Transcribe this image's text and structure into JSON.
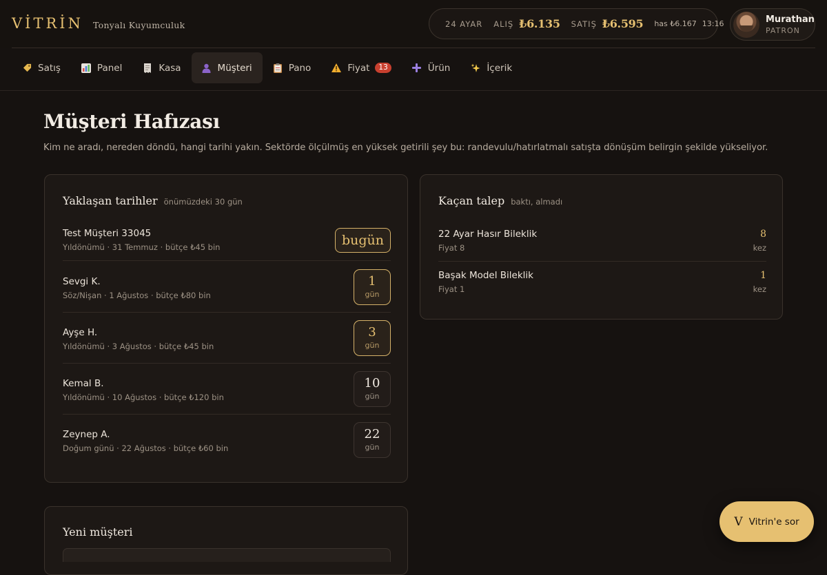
{
  "brand": {
    "logo": "VİTRİN",
    "subtitle": "Tonyalı Kuyumculuk"
  },
  "ticker": {
    "karat": "24 AYAR",
    "buy_label": "ALIŞ",
    "buy_value": "₺6.135",
    "sell_label": "SATIŞ",
    "sell_value": "₺6.595",
    "has": "has ₺6.167",
    "time": "13:16",
    "status_color": "#7fa36a"
  },
  "user": {
    "name": "Murathan",
    "role": "PATRON"
  },
  "nav": {
    "items": [
      {
        "label": "Satış",
        "icon": "tag-icon"
      },
      {
        "label": "Panel",
        "icon": "bar-chart-icon"
      },
      {
        "label": "Kasa",
        "icon": "receipt-icon"
      },
      {
        "label": "Müşteri",
        "icon": "person-icon"
      },
      {
        "label": "Pano",
        "icon": "clipboard-icon"
      },
      {
        "label": "Fiyat",
        "icon": "warning-icon",
        "badge": "13"
      },
      {
        "label": "Ürün",
        "icon": "plus-icon"
      },
      {
        "label": "İçerik",
        "icon": "sparkles-icon"
      }
    ]
  },
  "page": {
    "title": "Müşteri Hafızası",
    "subtitle": "Kim ne aradı, nereden döndü, hangi tarihi yakın. Sektörde ölçülmüş en yüksek getirili şey bu: randevulu/hatırlatmalı satışta dönüşüm belirgin şekilde yükseliyor."
  },
  "upcoming": {
    "title": "Yaklaşan tarihler",
    "hint": "önümüzdeki 30 gün",
    "today_label": "bugün",
    "day_unit": "gün",
    "rows": [
      {
        "name": "Test Müşteri 33045",
        "meta": "Yıldönümü · 31 Temmuz · bütçe ₺45 bin",
        "days": "bugün"
      },
      {
        "name": "Sevgi K.",
        "meta": "Söz/Nişan · 1 Ağustos · bütçe ₺80 bin",
        "days": "1"
      },
      {
        "name": "Ayşe H.",
        "meta": "Yıldönümü · 3 Ağustos · bütçe ₺45 bin",
        "days": "3"
      },
      {
        "name": "Kemal B.",
        "meta": "Yıldönümü · 10 Ağustos · bütçe ₺120 bin",
        "days": "10"
      },
      {
        "name": "Zeynep A.",
        "meta": "Doğum günü · 22 Ağustos · bütçe ₺60 bin",
        "days": "22"
      }
    ]
  },
  "lost": {
    "title": "Kaçan talep",
    "hint": "baktı, almadı",
    "unit": "kez",
    "rows": [
      {
        "name": "22 Ayar Hasır Bileklik",
        "meta": "Fiyat 8",
        "count": "8"
      },
      {
        "name": "Başak Model Bileklik",
        "meta": "Fiyat 1",
        "count": "1"
      }
    ]
  },
  "new_customer": {
    "title": "Yeni müşteri"
  },
  "assistant": {
    "letter": "V",
    "label": "Vitrin'e sor"
  },
  "colors": {
    "accent": "#e6c071",
    "badge": "#c8402f",
    "background": "#161210"
  }
}
